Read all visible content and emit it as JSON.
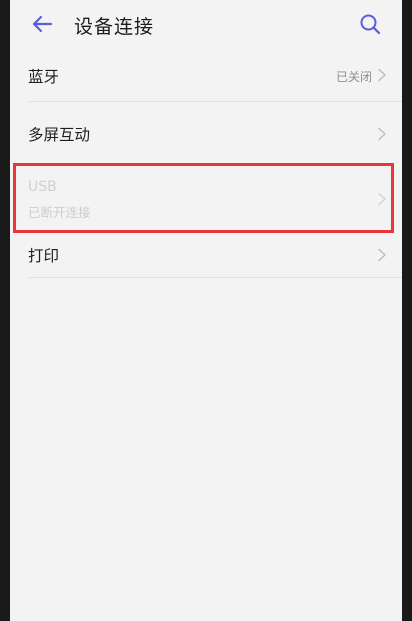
{
  "header": {
    "title": "设备连接",
    "back_icon": "arrow-left-icon",
    "search_icon": "search-icon",
    "accent_color": "#5b5be0"
  },
  "settings": {
    "bluetooth": {
      "label": "蓝牙",
      "value": "已关闭"
    },
    "multi_screen": {
      "label": "多屏互动"
    },
    "usb": {
      "label": "USB",
      "status": "已断开连接"
    },
    "print": {
      "label": "打印"
    }
  },
  "colors": {
    "background": "#f3f3f3",
    "highlight_border": "#e8363a"
  }
}
